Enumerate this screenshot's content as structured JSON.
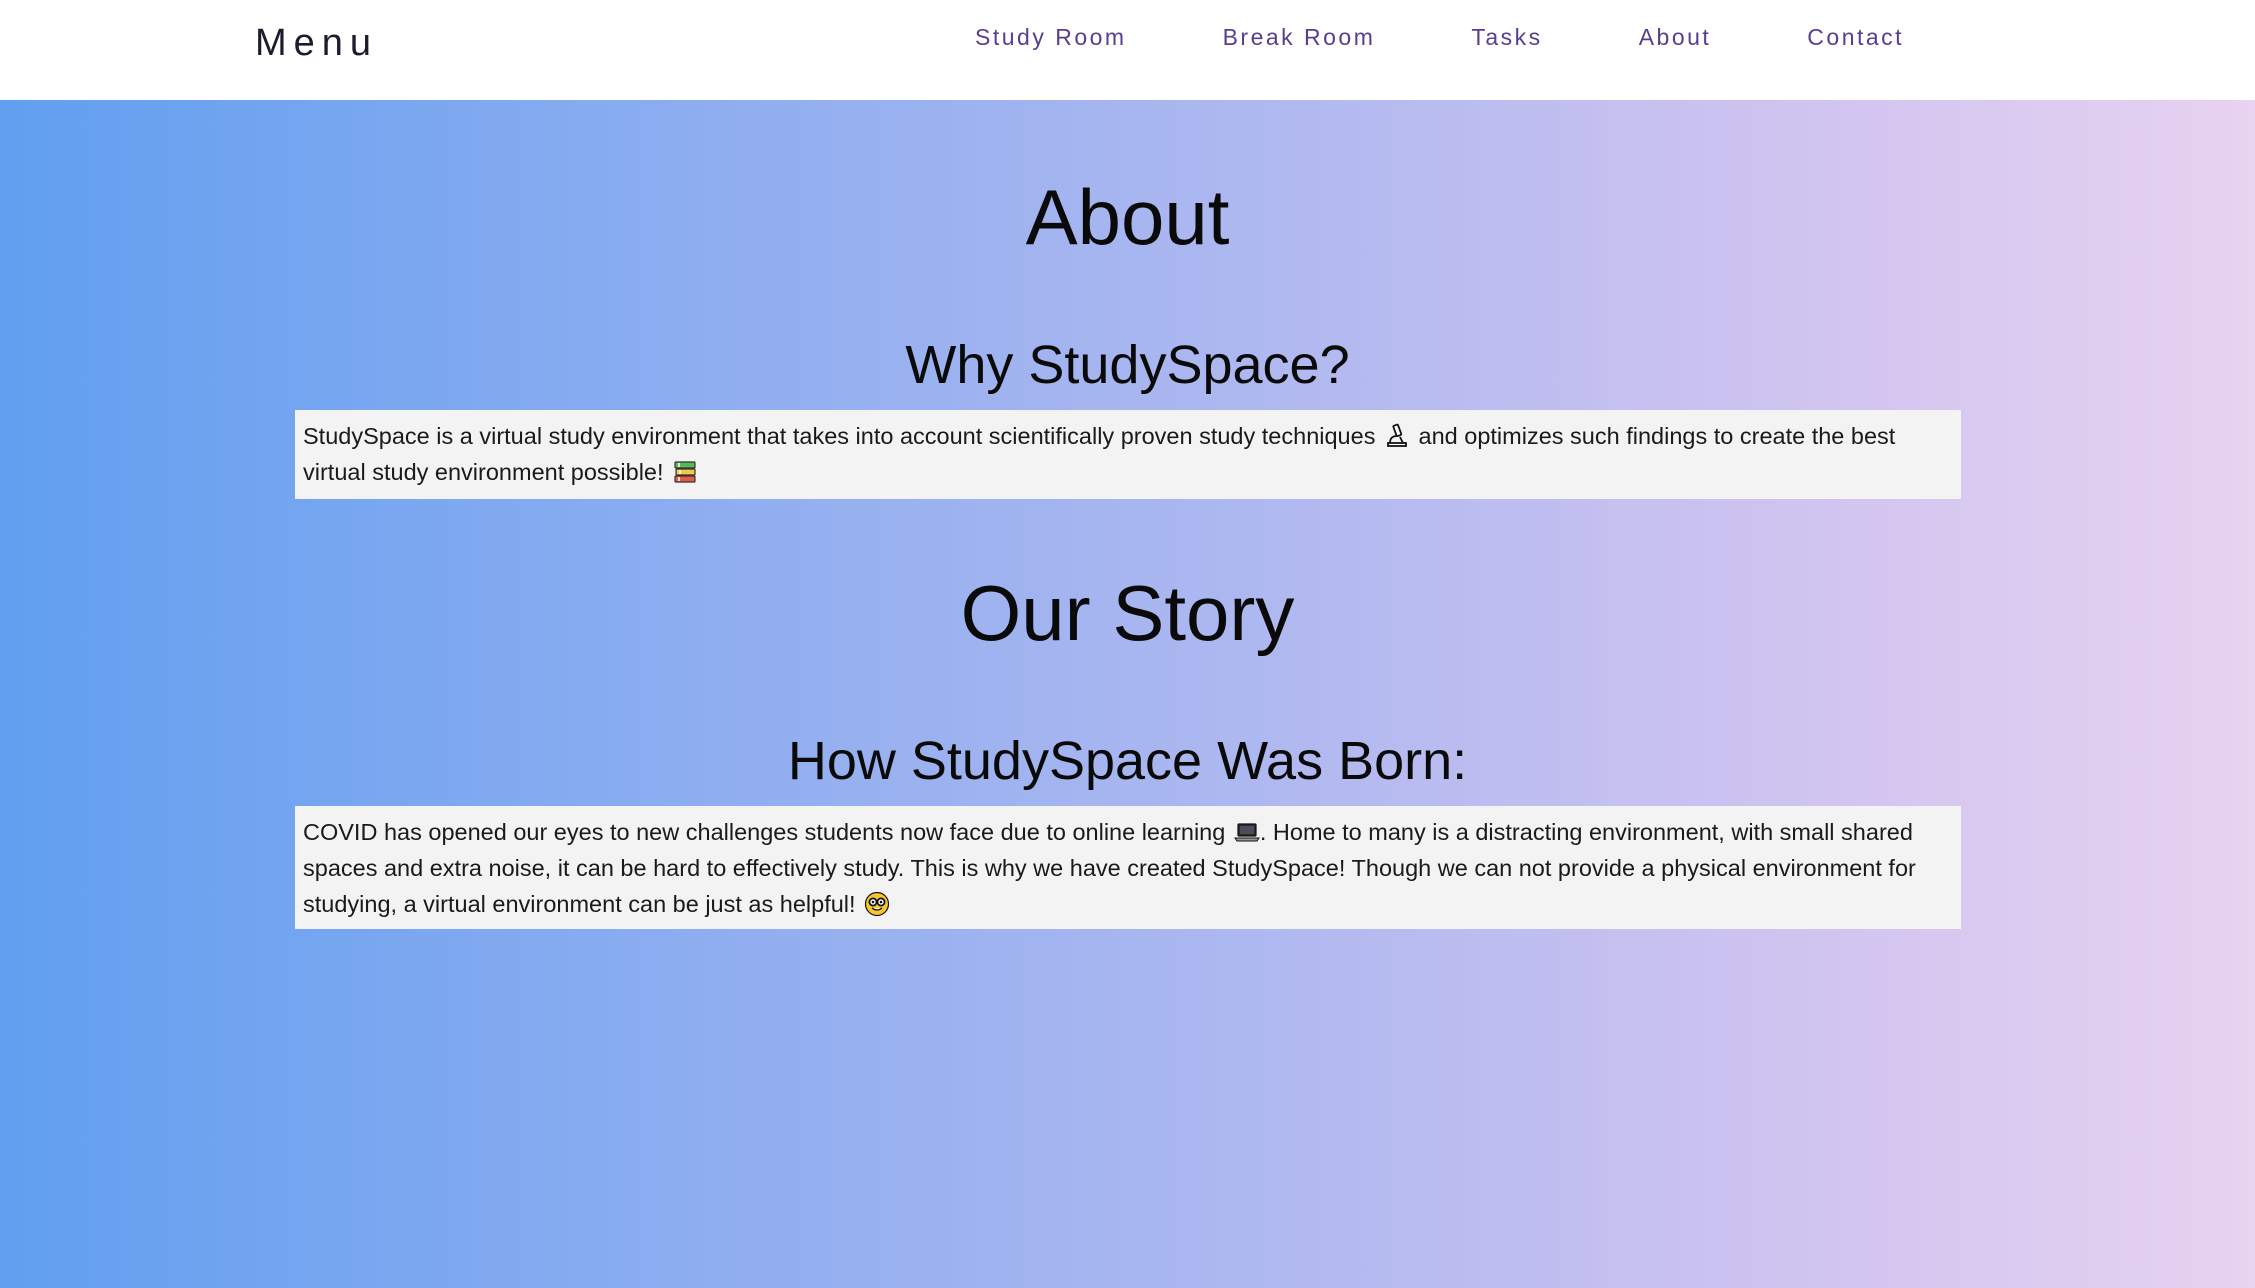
{
  "nav": {
    "brand": "Menu",
    "links": [
      "Study Room",
      "Break Room",
      "Tasks",
      "About",
      "Contact"
    ]
  },
  "main": {
    "title": "About",
    "why_heading": "Why StudySpace?",
    "why_text_part1": "StudySpace is a virtual study environment that takes into account scientifically proven study techniques",
    "why_text_part2": "and optimizes such findings to create the best virtual study environment possible!",
    "story_heading": "Our Story",
    "born_heading": "How StudySpace Was Born:",
    "born_text_part1": "COVID has opened our eyes to new challenges students now face due to online learning",
    "born_text_part2": ". Home to many is a distracting environment, with small shared spaces and extra noise, it can be hard to effectively study. This is why we have created StudySpace! Though we can not provide a physical environment for studying, a virtual environment can be just as helpful!"
  },
  "icons": {
    "microscope": "microscope-icon",
    "books": "books-icon",
    "laptop": "laptop-icon",
    "nerd_face": "nerd-face-icon"
  },
  "colors": {
    "gradient_start": "#619ff0",
    "gradient_end": "#e8d3f0",
    "nav_link": "#5a3d8f",
    "panel_bg": "#f3f3f3"
  }
}
